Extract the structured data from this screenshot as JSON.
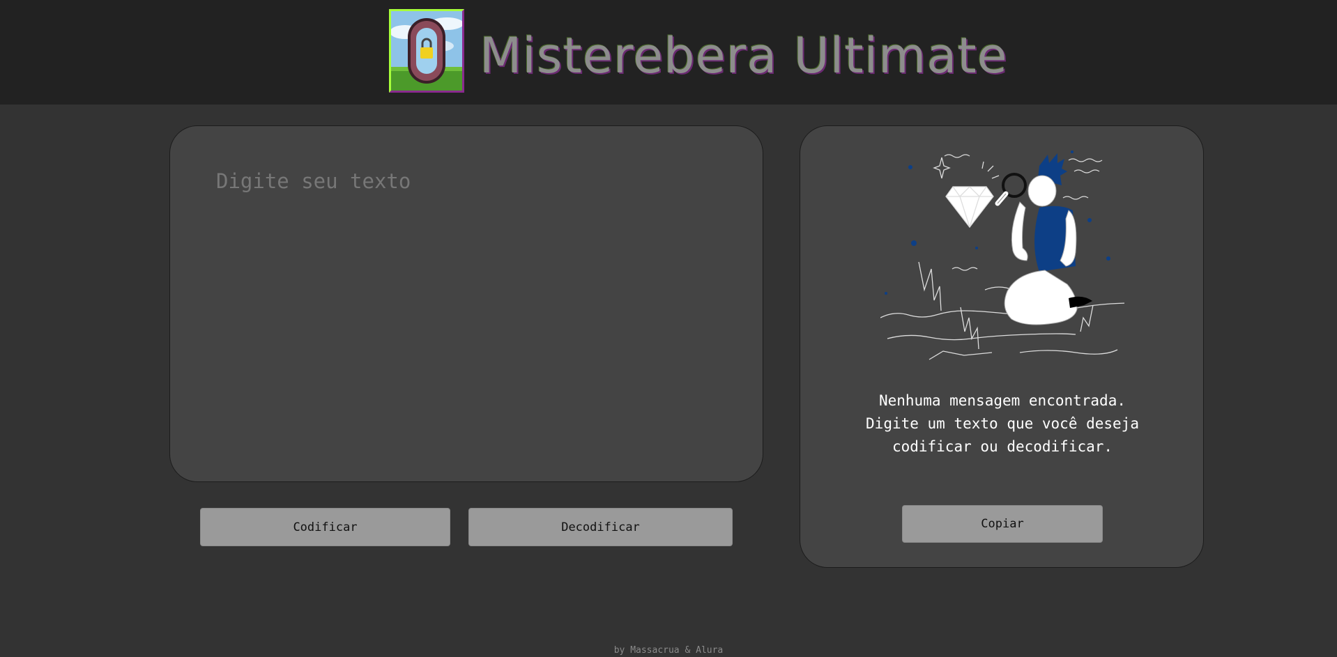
{
  "header": {
    "title": "Misterebera Ultimate",
    "logo_icon": "padlock-badge-icon"
  },
  "input": {
    "placeholder": "Digite seu texto",
    "value": ""
  },
  "actions": {
    "encode_label": "Codificar",
    "decode_label": "Decodificar"
  },
  "output": {
    "illustration_icon": "detective-magnifier-illustration",
    "message_lines": [
      "Nenhuma mensagem encontrada.",
      "Digite um texto que você deseja",
      "codificar ou decodificar."
    ],
    "copy_label": "Copiar"
  },
  "footer": {
    "credit": "by Massacrua & Alura"
  },
  "colors": {
    "page_background": "#333333",
    "header_background": "#222222",
    "panel_background": "#444444",
    "button_background": "#9a9a9a",
    "illustration_accent": "#0d3f86"
  }
}
